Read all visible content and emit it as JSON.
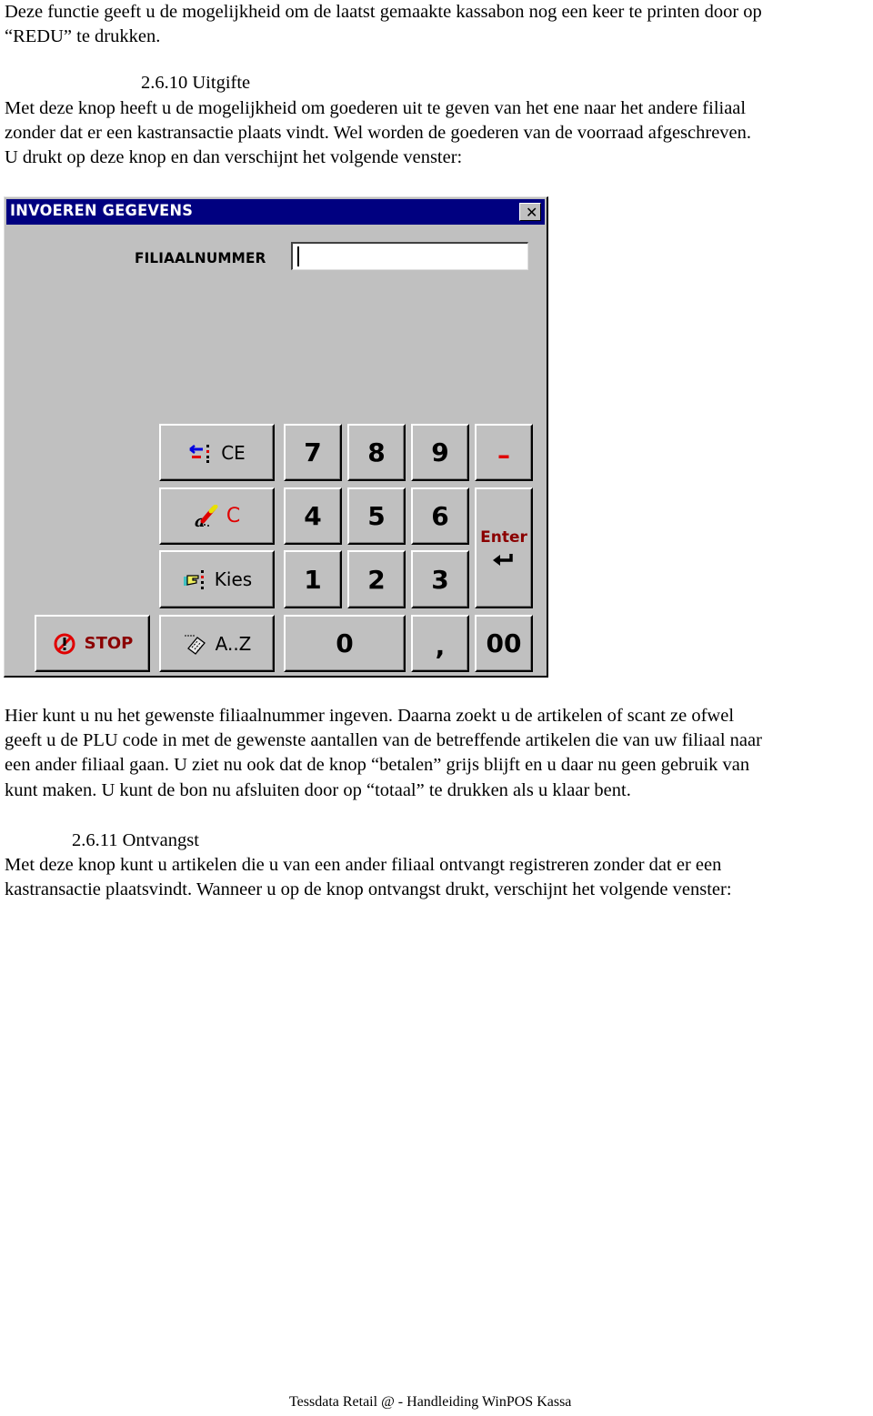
{
  "document": {
    "intro_lines": [
      "Deze functie geeft u de mogelijkheid om de laatst gemaakte kassabon nog een keer te printen door op",
      "“REDU” te drukken."
    ],
    "section1": {
      "heading": "2.6.10 Uitgifte",
      "lines": [
        "Met deze knop heeft u de mogelijkheid om goederen uit te geven van het ene naar het andere filiaal",
        "zonder dat er een kastransactie plaats vindt. Wel worden de goederen van de voorraad afgeschreven.",
        "U drukt op deze knop en dan verschijnt het volgende venster:"
      ]
    },
    "after_dialog_lines": [
      "Hier kunt u nu het gewenste filiaalnummer ingeven. Daarna zoekt u de artikelen of scant ze ofwel",
      "geeft u de PLU code in met de gewenste aantallen van de betreffende artikelen die van uw filiaal naar",
      "een ander filiaal gaan. U ziet nu ook dat de knop “betalen” grijs blijft en u daar nu geen gebruik van",
      "kunt maken. U kunt de bon nu afsluiten door op “totaal” te drukken als u klaar bent."
    ],
    "section2": {
      "heading": "2.6.11 Ontvangst",
      "lines": [
        "Met deze knop kunt u artikelen die u van een ander filiaal ontvangt registreren zonder dat er een",
        "kastransactie plaatsvindt. Wanneer u op de knop ontvangst drukt, verschijnt het volgende venster:"
      ]
    },
    "footer": "Tessdata Retail @ - Handleiding WinPOS Kassa"
  },
  "dialog": {
    "title": "INVOEREN GEGEVENS",
    "close_label": "✕",
    "field_label": "FILIAALNUMMER",
    "field_value": "",
    "buttons": {
      "ce": {
        "label": "CE",
        "icon": "clear-entry-icon"
      },
      "c": {
        "label": "C",
        "icon": "eraser-icon"
      },
      "kies": {
        "label": "Kies",
        "icon": "pointing-hand-icon"
      },
      "stop": {
        "label": "STOP",
        "icon": "stop-icon"
      },
      "az": {
        "label": "A..Z",
        "icon": "keyboard-icon"
      },
      "n7": "7",
      "n8": "8",
      "n9": "9",
      "n4": "4",
      "n5": "5",
      "n6": "6",
      "n1": "1",
      "n2": "2",
      "n3": "3",
      "n0": "0",
      "comma": ",",
      "n00": "00",
      "minus": "–",
      "enter": {
        "label": "Enter",
        "icon": "return-arrow-icon"
      }
    },
    "colors": {
      "titlebar": "#000080",
      "face": "#c0c0c0",
      "accent_red": "#e00000",
      "dark_red": "#8b0000"
    }
  }
}
